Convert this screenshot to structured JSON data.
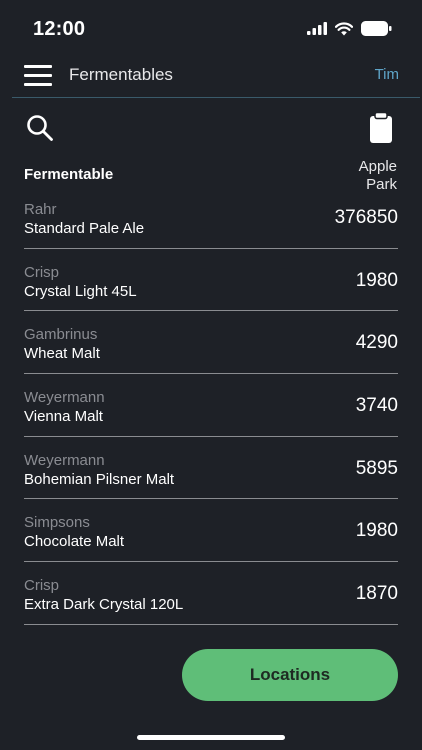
{
  "status_bar": {
    "time": "12:00"
  },
  "header": {
    "title": "Fermentables",
    "user": "Tim"
  },
  "table": {
    "column_header": "Fermentable",
    "location_header_line1": "Apple",
    "location_header_line2": "Park",
    "rows": [
      {
        "brand": "Rahr",
        "name": "Standard Pale Ale",
        "qty": "376850"
      },
      {
        "brand": "Crisp",
        "name": "Crystal Light 45L",
        "qty": "1980"
      },
      {
        "brand": "Gambrinus",
        "name": "Wheat Malt",
        "qty": "4290"
      },
      {
        "brand": "Weyermann",
        "name": "Vienna Malt",
        "qty": "3740"
      },
      {
        "brand": "Weyermann",
        "name": "Bohemian Pilsner Malt",
        "qty": "5895"
      },
      {
        "brand": "Simpsons",
        "name": "Chocolate Malt",
        "qty": "1980"
      },
      {
        "brand": "Crisp",
        "name": "Extra Dark Crystal 120L",
        "qty": "1870"
      }
    ]
  },
  "actions": {
    "locations_label": "Locations"
  },
  "colors": {
    "background": "#1e2127",
    "accent": "#5fbe78",
    "link": "#5fa5c8"
  }
}
